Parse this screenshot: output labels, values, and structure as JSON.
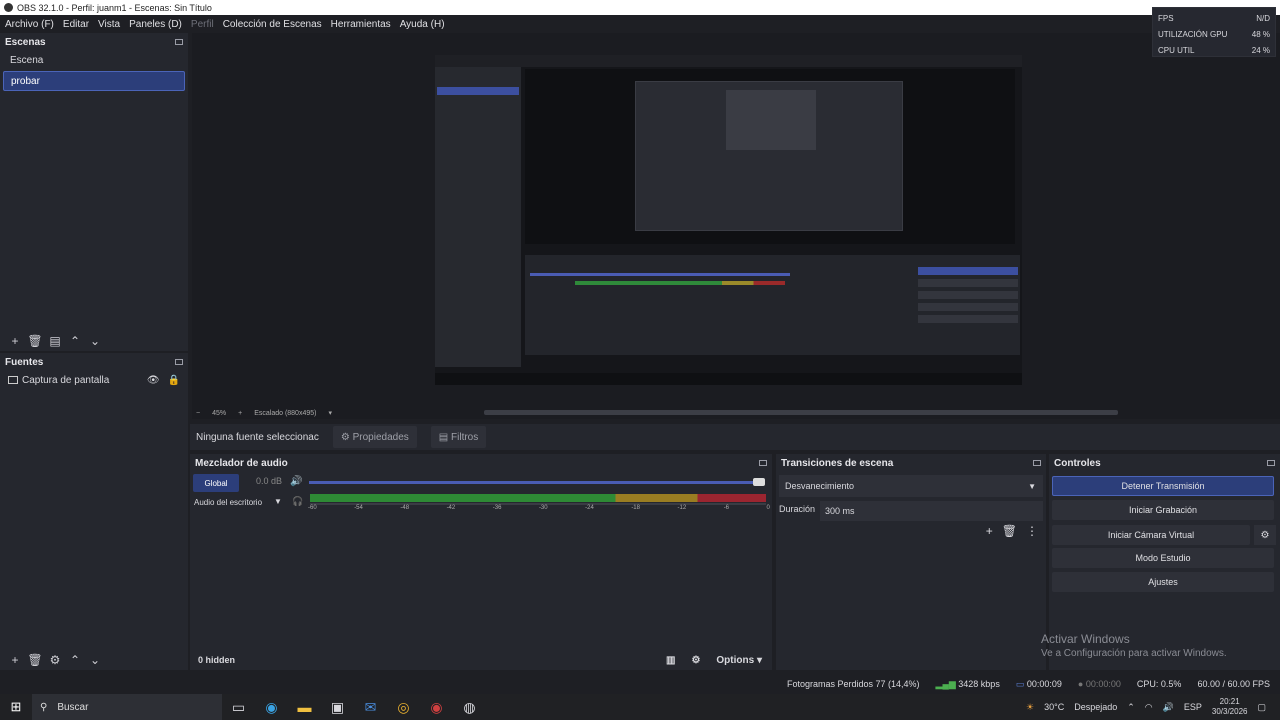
{
  "window": {
    "title": "OBS 32.1.0 - Perfil: juanm1 - Escenas: Sin Título"
  },
  "menu": [
    "Archivo (F)",
    "Editar",
    "Vista",
    "Paneles (D)",
    "Perfil",
    "Colección de Escenas",
    "Herramientas",
    "Ayuda (H)"
  ],
  "stats": {
    "fps_label": "FPS",
    "fps_value": "N/D",
    "gpu_label": "UTILIZACIÓN GPU",
    "gpu_value": "48 %",
    "cpu_label": "CPU UTIL",
    "cpu_value": "24 %"
  },
  "scenes": {
    "title": "Escenas",
    "items": [
      "Escena",
      "probar"
    ],
    "selected": "probar"
  },
  "sources": {
    "title": "Fuentes",
    "items": [
      "Captura de pantalla"
    ]
  },
  "preview": {
    "zoom": "45%",
    "scale": "Escalado (880x495)",
    "watermark_line1": "Activar Windows",
    "watermark_line2": "Ve a Configuración para activar Windows."
  },
  "context": {
    "no_source": "Ninguna fuente seleccionac",
    "properties": "Propiedades",
    "filters": "Filtros"
  },
  "mixer": {
    "title": "Mezclador de audio",
    "global": "Global",
    "global_db": "0.0 dB",
    "channel": "Audio del escritorio",
    "ticks": [
      "-60",
      "-54",
      "-48",
      "-42",
      "-36",
      "-30",
      "-24",
      "-18",
      "-12",
      "-6",
      "0"
    ],
    "hidden": "0 hidden",
    "options": "Options"
  },
  "transitions": {
    "title": "Transiciones de escena",
    "selected": "Desvanecimiento",
    "duration_label": "Duración",
    "duration_value": "300 ms"
  },
  "controls": {
    "title": "Controles",
    "stop_stream": "Detener Transmisión",
    "start_record": "Iniciar Grabación",
    "virtual_cam": "Iniciar Cámara Virtual",
    "studio_mode": "Modo Estudio",
    "settings": "Ajustes"
  },
  "status": {
    "dropped": "Fotogramas Perdidos 77 (14,4%)",
    "bitrate": "3428 kbps",
    "stream_time": "00:00:09",
    "record_time": "00:00:00",
    "cpu": "CPU: 0.5%",
    "fps": "60.00 / 60.00 FPS"
  },
  "taskbar": {
    "search": "Buscar",
    "weather_temp": "30°C",
    "weather_desc": "Despejado",
    "lang": "ESP",
    "time": "20:21",
    "date": "30/3/2026"
  },
  "colors": {
    "accent": "#2c3e7a",
    "panel": "#25272e",
    "background": "#1e1f24"
  }
}
